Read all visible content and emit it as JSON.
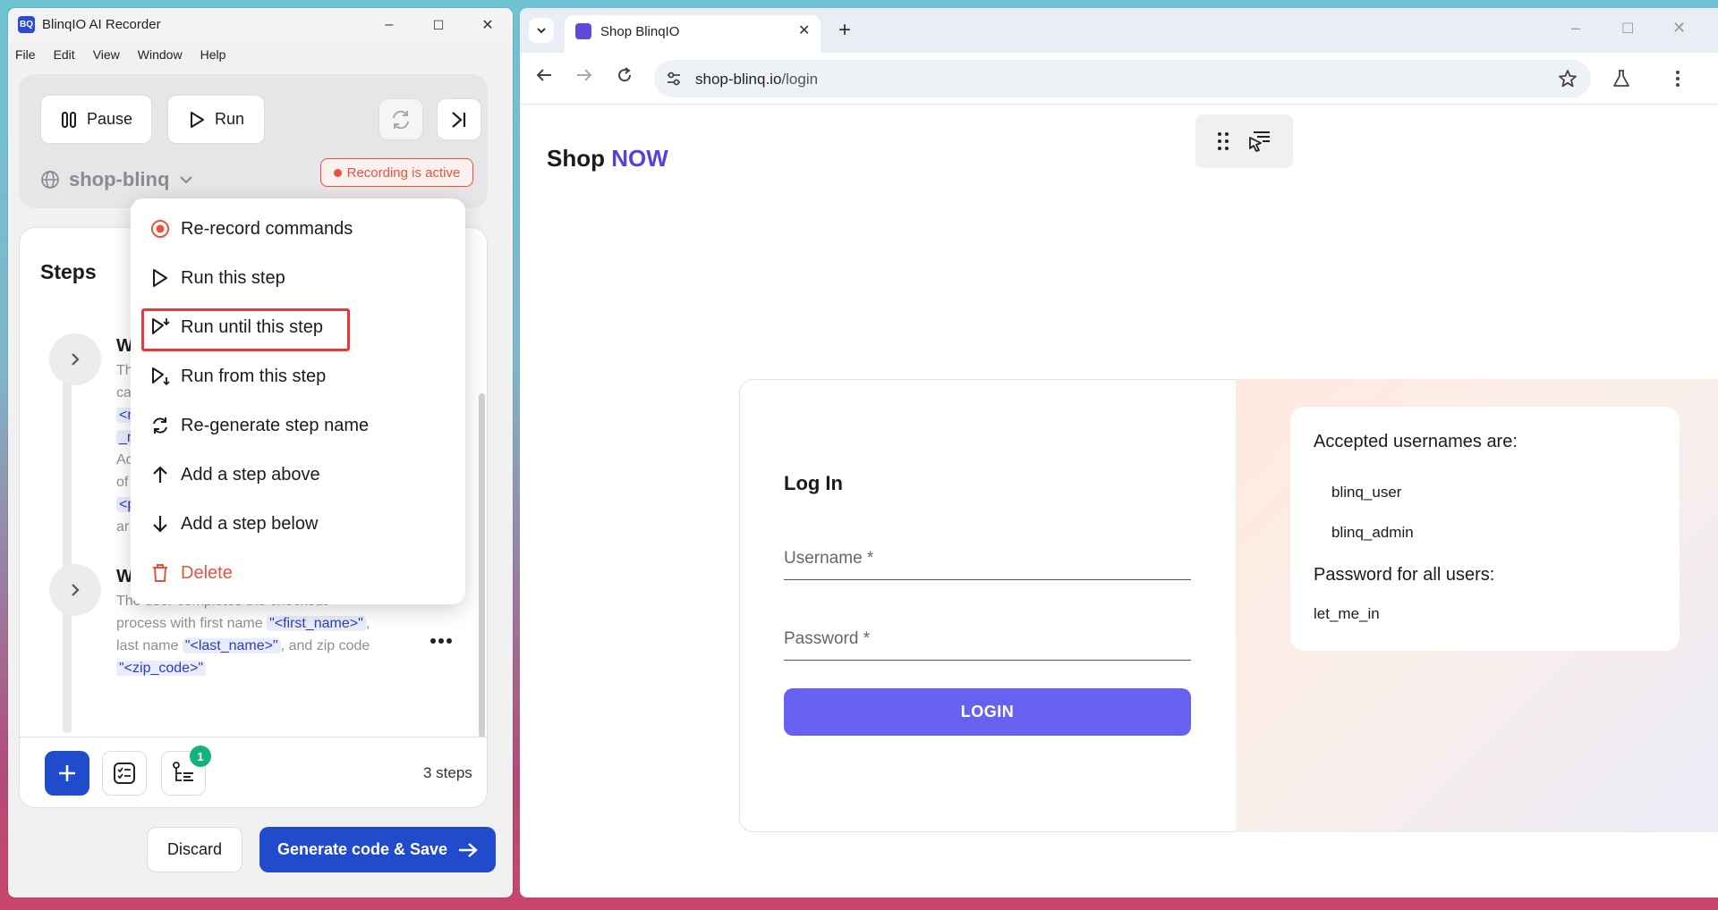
{
  "recorder": {
    "title": "BlinqIO AI Recorder",
    "logo_text": "BQ",
    "window_controls": {
      "minimize": "–",
      "maximize": "☐",
      "close": "✕"
    },
    "menu": [
      "File",
      "Edit",
      "View",
      "Window",
      "Help"
    ],
    "pause_label": "Pause",
    "run_label": "Run",
    "project_name": "shop-blinq",
    "recording_badge": "Recording is active",
    "steps_title": "Steps",
    "steps": [
      {
        "title_fragment": "W",
        "text_lines": [
          "Th",
          "ca",
          "<n",
          "_n",
          "Ac",
          "of",
          "<p",
          "ar"
        ]
      },
      {
        "title_fragment": "W",
        "text_prefix": "The user completes the checkout",
        "text_parts": [
          "process with first name ",
          "\"<first_name>\"",
          ", last name ",
          "\"<last_name>\"",
          ", and zip code ",
          "\"<zip_code>\""
        ]
      }
    ],
    "notification_count": "1",
    "steps_count": "3 steps",
    "discard_label": "Discard",
    "generate_label": "Generate code & Save"
  },
  "context_menu": {
    "items": [
      {
        "label": "Re-record commands",
        "icon": "record-icon",
        "danger": false
      },
      {
        "label": "Run this step",
        "icon": "play-icon",
        "danger": false
      },
      {
        "label": "Run until this step",
        "icon": "play-until-icon",
        "danger": false,
        "highlighted": true
      },
      {
        "label": "Run from this step",
        "icon": "play-from-icon",
        "danger": false
      },
      {
        "label": "Re-generate step name",
        "icon": "refresh-icon",
        "danger": false
      },
      {
        "label": "Add a step above",
        "icon": "arrow-up-icon",
        "danger": false
      },
      {
        "label": "Add a step below",
        "icon": "arrow-down-icon",
        "danger": false
      },
      {
        "label": "Delete",
        "icon": "trash-icon",
        "danger": true
      }
    ]
  },
  "browser": {
    "tab_title": "Shop BlinqIO",
    "url_host": "shop-blinq.io",
    "url_path": "/login",
    "page": {
      "brand_first": "Shop ",
      "brand_second": "NOW",
      "login_heading": "Log In",
      "username_label": "Username *",
      "password_label": "Password *",
      "login_button": "LOGIN",
      "accepted_heading": "Accepted usernames are:",
      "usernames": [
        "blinq_user",
        "blinq_admin"
      ],
      "password_heading": "Password for all users:",
      "password_value": "let_me_in"
    }
  },
  "colors": {
    "accent_blue": "#1f4bcc",
    "recording_red": "#e5533d",
    "login_purple": "#6761f0",
    "brand_now": "#5a3ee0",
    "badge_green": "#14b37d"
  }
}
